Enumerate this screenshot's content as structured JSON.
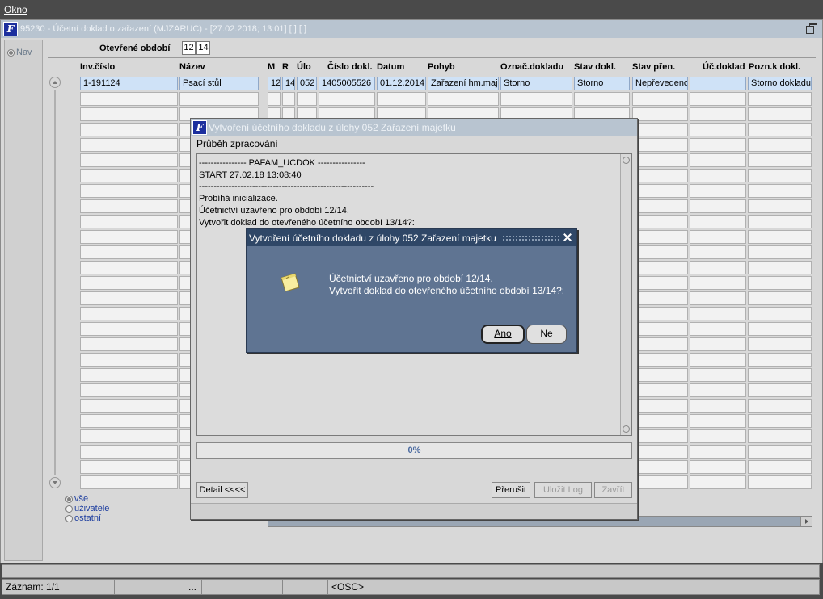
{
  "menubar": {
    "okno": "Okno"
  },
  "form": {
    "title": "95230 - Účetní doklad o zařazení (MJZARUC) - [27.02.2018; 13:01]  [ ]  [ ]",
    "nav_label": "Nav",
    "period_label": "Otevřené období",
    "period_month": "12",
    "period_year": "14",
    "columns": [
      "Inv.číslo",
      "Název",
      "M",
      "R",
      "Úlo",
      "Číslo dokl.",
      "Datum",
      "Pohyb",
      "Označ.dokladu",
      "Stav dokl.",
      "Stav přen.",
      "Úč.doklad",
      "Pozn.k dokl."
    ],
    "row1": [
      "1-191124",
      "Psací stůl",
      "12",
      "14",
      "052",
      "1405005526",
      "01.12.2014",
      "Zařazení hm.maje",
      "Storno",
      "Storno",
      "Nepřevedeno",
      "",
      "Storno dokladu"
    ],
    "filter": {
      "all": "vše",
      "users": "uživatele",
      "others": "ostatní"
    }
  },
  "status": {
    "record": "Záznam: 1/1",
    "ellipsis": "...",
    "osc": "<OSC>"
  },
  "progress_dialog": {
    "title": "Vytvoření účetního dokladu z úlohy 052 Zařazení majetku",
    "label": "Průběh zpracování",
    "log_lines": [
      "---------------- PAFAM_UCDOK ----------------",
      "START 27.02.18 13:08:40",
      "-----------------------------------------------------------",
      "Probíhá inicializace.",
      "Účetnictví uzavřeno pro období 12/14.",
      "Vytvořit doklad do otevřeného účetního období 13/14?:"
    ],
    "progress_text": "0%",
    "progress_value": 0,
    "btn_detail": "Detail <<<<",
    "btn_abort": "Přerušit",
    "btn_save_log": "Uložit Log",
    "btn_close": "Zavřít"
  },
  "confirm_dialog": {
    "title": "Vytvoření účetního dokladu z úlohy 052 Zařazení majetku",
    "message_line1": "Účetnictví uzavřeno pro období 12/14.",
    "message_line2": "Vytvořit doklad do otevřeného účetního období 13/14?:",
    "btn_yes": "Ano",
    "btn_no": "Ne",
    "icon": "note-icon"
  },
  "colors": {
    "confirm_bg": "#5f7492",
    "confirm_title": "#2f4767",
    "selected_row": "#cfe2f7",
    "title_bar": "#b8c4d0"
  }
}
